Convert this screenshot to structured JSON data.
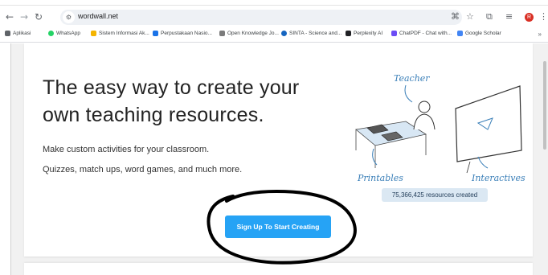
{
  "browser": {
    "url": "wordwall.net",
    "bookmarks": [
      {
        "label": "Aplikasi",
        "color": "#5f6368"
      },
      {
        "label": "WhatsApp",
        "color": "#25d366"
      },
      {
        "label": "Sistem Informasi Ak...",
        "color": "#f4b400"
      },
      {
        "label": "Perpustakaan Nasio...",
        "color": "#1a73e8"
      },
      {
        "label": "Open Knowledge Jo...",
        "color": "#7b7b7b"
      },
      {
        "label": "SINTA - Science and...",
        "color": "#1565c0"
      },
      {
        "label": "Perplexity AI",
        "color": "#202124"
      },
      {
        "label": "ChatPDF - Chat with...",
        "color": "#6c4cf5"
      },
      {
        "label": "Google Scholar",
        "color": "#4285f4"
      }
    ],
    "bookmarks_overflow": "»",
    "profile_initial": "R"
  },
  "hero": {
    "headline_line1": "The easy way to create your",
    "headline_line2": "own teaching resources.",
    "subtitle1": "Make custom activities for your classroom.",
    "subtitle2": "Quizzes, match ups, word games, and much more.",
    "cta_label": "Sign Up To Start Creating",
    "counter": "75,366,425 resources created",
    "illustration": {
      "label_teacher": "Teacher",
      "label_printables": "Printables",
      "label_interactives": "Interactives"
    }
  },
  "colors": {
    "cta": "#26a3f5",
    "counter_bg": "#dbe8f3",
    "illustration_accent": "#3a7fb8",
    "annotation_ink": "#000000"
  }
}
